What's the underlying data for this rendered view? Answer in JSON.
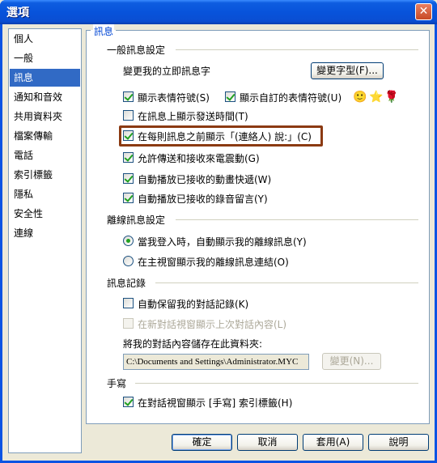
{
  "window": {
    "title": "選項",
    "close_glyph": "✕"
  },
  "sidebar": {
    "items": [
      {
        "label": "個人"
      },
      {
        "label": "一般"
      },
      {
        "label": "訊息"
      },
      {
        "label": "通知和音效"
      },
      {
        "label": "共用資料夾"
      },
      {
        "label": "檔案傳輸"
      },
      {
        "label": "電話"
      },
      {
        "label": "索引標籤"
      },
      {
        "label": "隱私"
      },
      {
        "label": "安全性"
      },
      {
        "label": "連線"
      }
    ],
    "selected_index": 2
  },
  "panel": {
    "title": "訊息",
    "general": {
      "title": "一般訊息設定",
      "font_label": "變更我的立即訊息字",
      "font_button": "變更字型(F)...",
      "show_emoticons": {
        "label": "顯示表情符號(S)",
        "checked": true
      },
      "show_custom_emoticons": {
        "label": "顯示自訂的表情符號(U)",
        "checked": true
      },
      "emoticon_glyphs": [
        "🙂",
        "⭐",
        "🌹"
      ],
      "show_timestamps": {
        "label": "在訊息上顯示發送時間(T)",
        "checked": false
      },
      "show_says": {
        "label": "在每則訊息之前顯示「(連絡人) 說:」(C)",
        "checked": true
      },
      "allow_nudges": {
        "label": "允許傳送和接收來電震動(G)",
        "checked": true
      },
      "autoplay_winks": {
        "label": "自動播放已接收的動畫快遞(W)",
        "checked": true
      },
      "autoplay_voice": {
        "label": "自動播放已接收的錄音留言(Y)",
        "checked": true
      }
    },
    "offline": {
      "title": "離線訊息設定",
      "option_signin": {
        "label": "當我登入時，自動顯示我的離線訊息(Y)",
        "checked": true
      },
      "option_link": {
        "label": "在主視窗顯示我的離線訊息連結(O)",
        "checked": false
      }
    },
    "history": {
      "title": "訊息記錄",
      "auto_save": {
        "label": "自動保留我的對話記錄(K)",
        "checked": false
      },
      "show_previous": {
        "label": "在新對話視窗顯示上次對話內容(L)",
        "checked": false,
        "disabled": true
      },
      "folder_label": "將我的對話內容儲存在此資料夾:",
      "folder_path": "C:\\Documents and Settings\\Administrator.MYC",
      "change_button": "變更(N)..."
    },
    "handwriting": {
      "title": "手寫",
      "show_tab": {
        "label": "在對話視窗顯示 [手寫] 索引標籤(H)",
        "checked": true
      }
    }
  },
  "footer": {
    "ok": "確定",
    "cancel": "取消",
    "apply": "套用(A)",
    "help": "說明"
  }
}
